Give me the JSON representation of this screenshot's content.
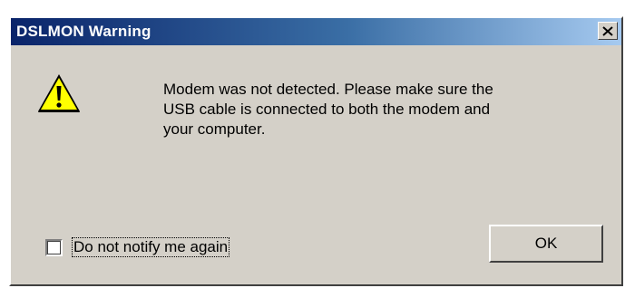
{
  "window": {
    "title": "DSLMON Warning"
  },
  "titlebar": {
    "close_icon": "close-icon"
  },
  "dialog": {
    "icon": "warning-icon",
    "message": "Modem was not detected. Please make sure the\nUSB cable is connected to both  the modem and\nyour computer.",
    "checkbox_label": "Do not notify me again",
    "checkbox_checked": false,
    "ok_label": "OK"
  },
  "colors": {
    "title_gradient_start": "#0a246a",
    "title_gradient_end": "#a6caf0",
    "face": "#d4d0c8",
    "warning_yellow": "#ffff00"
  }
}
